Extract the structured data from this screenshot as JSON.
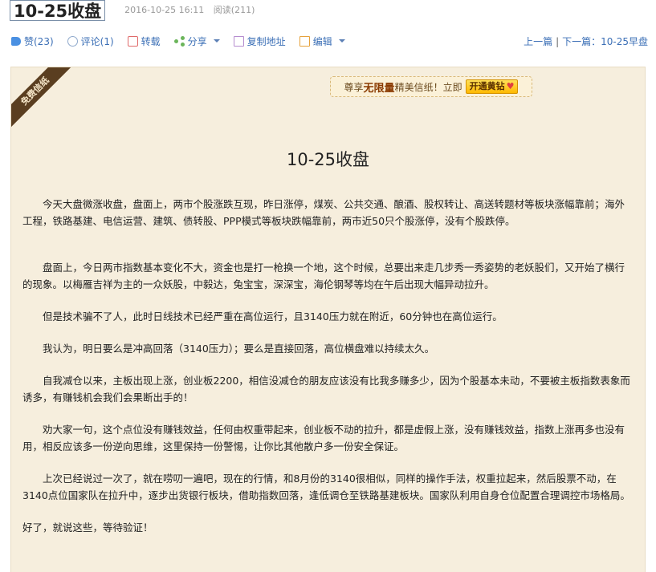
{
  "post": {
    "title": "10-25收盘",
    "datetime": "2016-10-25 16:11",
    "views": "阅读(211)"
  },
  "toolbar": {
    "like": "赞(23)",
    "comment": "评论(1)",
    "repost": "转载",
    "share": "分享",
    "copy_link": "复制地址",
    "edit": "编辑"
  },
  "nav": {
    "prev": "上一篇",
    "next": "下一篇：10-25早盘"
  },
  "paper": {
    "ribbon": "免费信纸",
    "promo_prefix": "尊享",
    "promo_highlight": "无限量",
    "promo_suffix": "精美信纸！立即",
    "promo_button": "开通黄钻",
    "content_title": "10-25收盘",
    "paragraphs": [
      "　　今天大盘微涨收盘，盘面上，两市个股涨跌互现，昨日涨停，煤炭、公共交通、酿酒、股权转让、高送转题材等板块涨幅靠前；海外工程，铁路基建、电信运营、建筑、债转股、PPP模式等板块跌幅靠前，两市近50只个股涨停，没有个股跌停。",
      "　　盘面上，今日两市指数基本变化不大，资金也是打一枪换一个地，这个时候，总要出来走几步秀一秀姿势的老妖股们，又开始了横行的现象。以梅雁吉祥为主的一众妖股，中毅达，兔宝宝，深深宝，海伦钢琴等均在午后出现大幅异动拉升。",
      "　　但是技术骗不了人，此时日线技术已经严重在高位运行，且3140压力就在附近，60分钟也在高位运行。",
      "　　我认为，明日要么是冲高回落（3140压力）；要么是直接回落，高位横盘难以持续太久。",
      "　　自我减仓以来，主板出现上涨，创业板2200，相信没减仓的朋友应该没有比我多赚多少，因为个股基本未动，不要被主板指数表象而诱多，有赚钱机会我们会果断出手的！",
      "　　劝大家一句，这个点位没有赚钱效益，任何由权重带起来，创业板不动的拉升，都是虚假上涨，没有赚钱效益，指数上涨再多也没有用，相反应该多一份逆向思维，这里保持一份警惕，让你比其他散户多一份安全保证。",
      "　　上次已经说过一次了，就在唠叨一遍吧，现在的行情，和8月份的3140很相似，同样的操作手法，权重拉起来，然后股票不动，在3140点位国家队在拉升中，逐步出货银行板块，借助指数回落，逢低调仓至铁路基建板块。国家队利用自身仓位配置合理调控市场格局。",
      "好了，就说这些，等待验证！"
    ]
  }
}
